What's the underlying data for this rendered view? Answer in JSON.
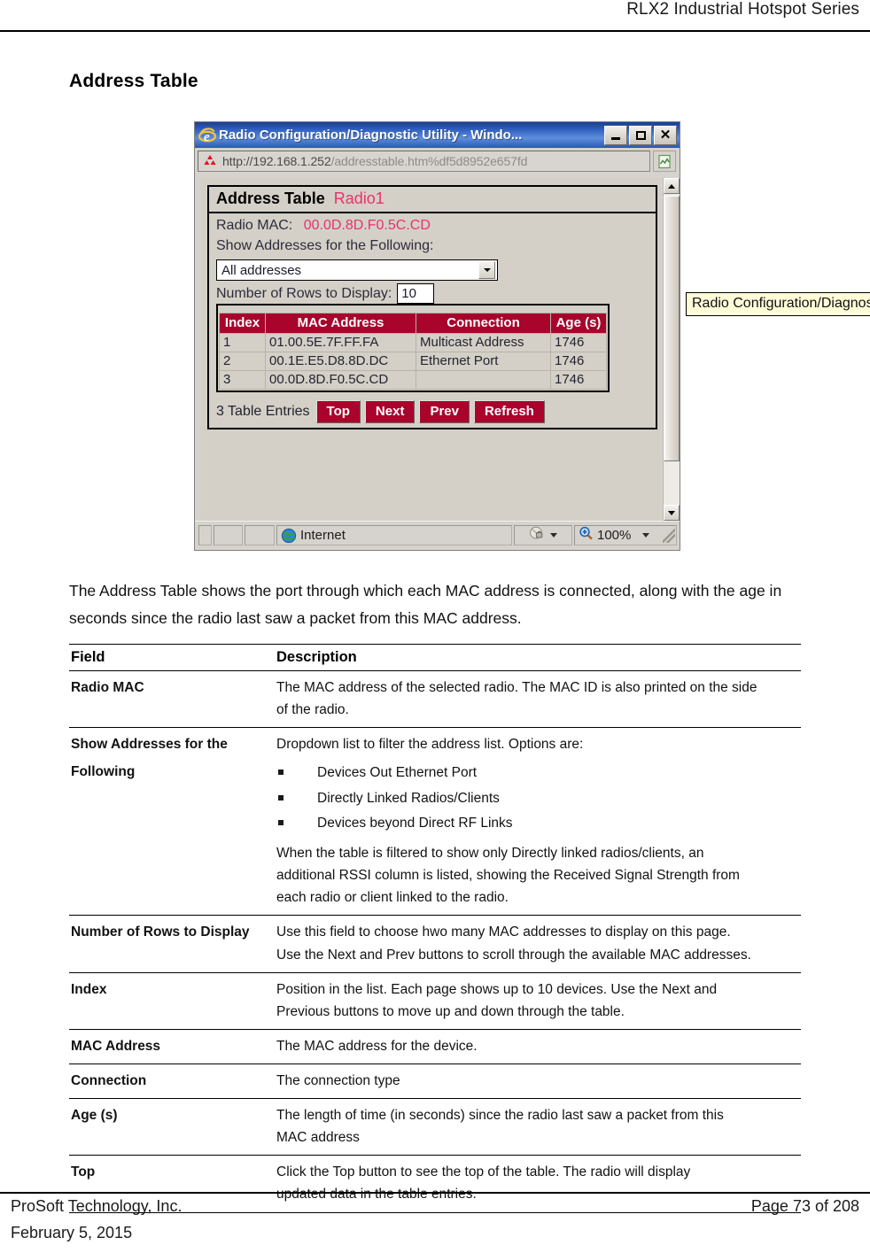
{
  "page_header": {
    "title": "RLX2 Industrial Hotspot Series"
  },
  "section": {
    "heading": "Address Table"
  },
  "browser": {
    "titlebar": {
      "text": "Radio Configuration/Diagnostic Utility - Windo...",
      "app_icon": "internet-explorer-icon",
      "minimize_label": "Minimize",
      "maximize_label": "Maximize",
      "close_label": "Close"
    },
    "address_bar": {
      "favicon": "prosoft-pyramid-icon",
      "url_visible": "http://192.168.1.252",
      "url_faded": "/addresstable.htm%df5d8952e657fd",
      "go_icon": "page-refresh-icon"
    },
    "tooltip": {
      "text": "Radio Configuration/Diagnos"
    },
    "scrollbar": {
      "up_icon": "scroll-up-arrow-icon",
      "down_icon": "scroll-down-arrow-icon"
    },
    "statusbar": {
      "zone_icon": "globe-icon",
      "zone_label": "Internet",
      "security_icon": "security-shield-icon",
      "zoom_icon": "zoom-magnifier-icon",
      "zoom_level": "100%",
      "resize_grip": "resize-grip-icon"
    }
  },
  "web_page": {
    "panel_title_main": "Address Table",
    "panel_title_radio": "Radio1",
    "radio_mac_label": "Radio MAC:",
    "radio_mac_value": "00.0D.8D.F0.5C.CD",
    "show_addresses_label": "Show Addresses for the Following:",
    "filter_selected": "All addresses",
    "rows_label": "Number of Rows to Display:",
    "rows_value": "10",
    "table": {
      "columns": [
        "Index",
        "MAC Address",
        "Connection",
        "Age (s)"
      ],
      "rows": [
        {
          "index": "1",
          "mac": "01.00.5E.7F.FF.FA",
          "connection": "Multicast Address",
          "age": "1746"
        },
        {
          "index": "2",
          "mac": "00.1E.E5.D8.8D.DC",
          "connection": "Ethernet Port",
          "age": "1746"
        },
        {
          "index": "3",
          "mac": "00.0D.8D.F0.5C.CD",
          "connection": "",
          "age": "1746"
        }
      ]
    },
    "entries_count": "3 Table Entries",
    "buttons": [
      "Top",
      "Next",
      "Prev",
      "Refresh"
    ]
  },
  "body_paragraph": "The Address Table shows the port through which each MAC address is connected, along with the age in seconds since the radio last saw a packet from this MAC address.",
  "doc_table": {
    "headers": [
      "Field",
      "Description"
    ],
    "rows": [
      {
        "field": "Radio MAC",
        "field_line2": "",
        "desc_lines": [
          "The MAC address of the selected radio. The MAC ID is also printed on the side",
          "of the radio."
        ],
        "bullets": [],
        "after_lines": []
      },
      {
        "field": "Show Addresses for the",
        "field_line2": "Following",
        "desc_lines": [
          "Dropdown list to filter the address list. Options are:"
        ],
        "bullets": [
          "Devices Out Ethernet Port",
          "Directly Linked Radios/Clients",
          "Devices beyond Direct RF Links"
        ],
        "after_lines": [
          "When the table is filtered to show only Directly linked radios/clients, an",
          "additional RSSI column is listed, showing the Received Signal Strength from",
          "each radio or client linked to the radio."
        ]
      },
      {
        "field": "Number of Rows to Display",
        "field_line2": "",
        "desc_lines": [
          "Use this field to choose hwo many MAC addresses to display on this page.",
          "Use the Next and Prev buttons to scroll through the available MAC addresses."
        ],
        "bullets": [],
        "after_lines": []
      },
      {
        "field": "Index",
        "field_line2": "",
        "desc_lines": [
          "Position in the list. Each page shows up to 10 devices. Use the Next and",
          "Previous buttons to move up and down through the table."
        ],
        "bullets": [],
        "after_lines": []
      },
      {
        "field": "MAC Address",
        "field_line2": "",
        "desc_lines": [
          "The MAC address for the device."
        ],
        "bullets": [],
        "after_lines": []
      },
      {
        "field": "Connection",
        "field_line2": "",
        "desc_lines": [
          "The connection type"
        ],
        "bullets": [],
        "after_lines": []
      },
      {
        "field": "Age (s)",
        "field_line2": "",
        "desc_lines": [
          "The length of time (in seconds) since the radio last saw a packet from this",
          "MAC address"
        ],
        "bullets": [],
        "after_lines": []
      },
      {
        "field": "Top",
        "field_line2": "",
        "desc_lines": [
          "Click the Top button to see the top of the table. The radio will display",
          "updated data in the table entries."
        ],
        "bullets": [],
        "after_lines": []
      }
    ]
  },
  "footer": {
    "company": "ProSoft Technology, Inc.",
    "page_number": "Page 73 of 208",
    "date": "February 5, 2015"
  },
  "colors": {
    "table_header_red": "#a8042c",
    "accent_pink": "#e8336b",
    "titlebar_blue": "#2f5fbf",
    "window_gray": "#d4d0c8",
    "tooltip_yellow": "#fdfbd8"
  }
}
